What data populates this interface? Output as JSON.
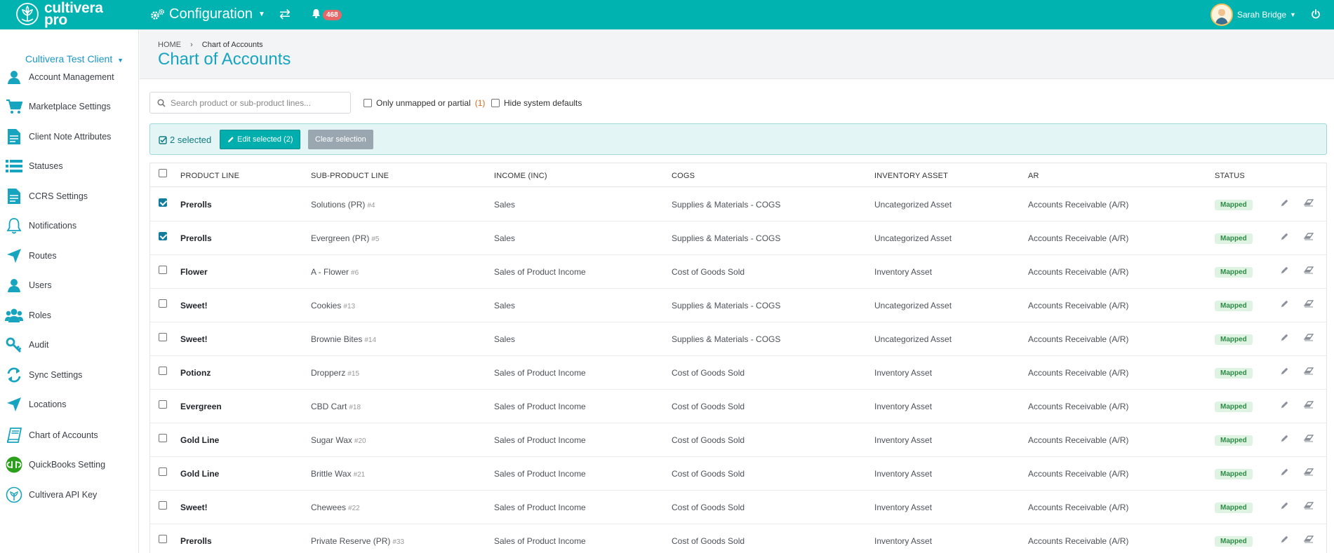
{
  "header": {
    "brand_line1": "cultivera",
    "brand_line2": "pro",
    "section": "Configuration",
    "notification_count": "468",
    "user_name": "Sarah Bridge",
    "icons": {
      "section": "gears-icon",
      "swap": "swap-arrows-icon",
      "bell": "bell-icon",
      "power": "power-icon"
    }
  },
  "sidebar": {
    "client": "Cultivera Test Client",
    "items": [
      {
        "label": "Account Management",
        "icon": "user-icon"
      },
      {
        "label": "Marketplace Settings",
        "icon": "cart-icon"
      },
      {
        "label": "Client Note Attributes",
        "icon": "document-icon"
      },
      {
        "label": "Statuses",
        "icon": "list-icon"
      },
      {
        "label": "CCRS Settings",
        "icon": "document-icon"
      },
      {
        "label": "Notifications",
        "icon": "bell-icon"
      },
      {
        "label": "Routes",
        "icon": "location-arrow-icon"
      },
      {
        "label": "Users",
        "icon": "user-icon"
      },
      {
        "label": "Roles",
        "icon": "users-icon"
      },
      {
        "label": "Audit",
        "icon": "key-icon"
      },
      {
        "label": "Sync Settings",
        "icon": "sync-icon"
      },
      {
        "label": "Locations",
        "icon": "location-arrow-icon"
      },
      {
        "label": "Chart of Accounts",
        "icon": "book-icon"
      },
      {
        "label": "QuickBooks Setting",
        "icon": "quickbooks-icon"
      },
      {
        "label": "Cultivera API Key",
        "icon": "api-key-icon"
      }
    ]
  },
  "breadcrumb": {
    "home": "HOME",
    "current": "Chart of Accounts"
  },
  "page_title": "Chart of Accounts",
  "filters": {
    "search_placeholder": "Search product or sub-product lines...",
    "only_unmapped_label": "Only unmapped or partial",
    "only_unmapped_count": "(1)",
    "hide_defaults_label": "Hide system defaults"
  },
  "selection": {
    "count_label": "2 selected",
    "edit_button": "Edit selected (2)",
    "clear_button": "Clear selection"
  },
  "table": {
    "columns": [
      "PRODUCT LINE",
      "SUB-PRODUCT LINE",
      "INCOME (INC)",
      "COGS",
      "INVENTORY ASSET",
      "AR",
      "STATUS"
    ],
    "rows": [
      {
        "checked": true,
        "product_line": "Prerolls",
        "sub_product": "Solutions (PR)",
        "sub_id": "#4",
        "income": "Sales",
        "cogs": "Supplies & Materials - COGS",
        "inventory": "Uncategorized Asset",
        "ar": "Accounts Receivable (A/R)",
        "status": "Mapped"
      },
      {
        "checked": true,
        "product_line": "Prerolls",
        "sub_product": "Evergreen (PR)",
        "sub_id": "#5",
        "income": "Sales",
        "cogs": "Supplies & Materials - COGS",
        "inventory": "Uncategorized Asset",
        "ar": "Accounts Receivable (A/R)",
        "status": "Mapped"
      },
      {
        "checked": false,
        "product_line": "Flower",
        "sub_product": "A - Flower",
        "sub_id": "#6",
        "income": "Sales of Product Income",
        "cogs": "Cost of Goods Sold",
        "inventory": "Inventory Asset",
        "ar": "Accounts Receivable (A/R)",
        "status": "Mapped"
      },
      {
        "checked": false,
        "product_line": "Sweet!",
        "sub_product": "Cookies",
        "sub_id": "#13",
        "income": "Sales",
        "cogs": "Supplies & Materials - COGS",
        "inventory": "Uncategorized Asset",
        "ar": "Accounts Receivable (A/R)",
        "status": "Mapped"
      },
      {
        "checked": false,
        "product_line": "Sweet!",
        "sub_product": "Brownie Bites",
        "sub_id": "#14",
        "income": "Sales",
        "cogs": "Supplies & Materials - COGS",
        "inventory": "Uncategorized Asset",
        "ar": "Accounts Receivable (A/R)",
        "status": "Mapped"
      },
      {
        "checked": false,
        "product_line": "Potionz",
        "sub_product": "Dropperz",
        "sub_id": "#15",
        "income": "Sales of Product Income",
        "cogs": "Cost of Goods Sold",
        "inventory": "Inventory Asset",
        "ar": "Accounts Receivable (A/R)",
        "status": "Mapped"
      },
      {
        "checked": false,
        "product_line": "Evergreen",
        "sub_product": "CBD Cart",
        "sub_id": "#18",
        "income": "Sales of Product Income",
        "cogs": "Cost of Goods Sold",
        "inventory": "Inventory Asset",
        "ar": "Accounts Receivable (A/R)",
        "status": "Mapped"
      },
      {
        "checked": false,
        "product_line": "Gold Line",
        "sub_product": "Sugar Wax",
        "sub_id": "#20",
        "income": "Sales of Product Income",
        "cogs": "Cost of Goods Sold",
        "inventory": "Inventory Asset",
        "ar": "Accounts Receivable (A/R)",
        "status": "Mapped"
      },
      {
        "checked": false,
        "product_line": "Gold Line",
        "sub_product": "Brittle Wax",
        "sub_id": "#21",
        "income": "Sales of Product Income",
        "cogs": "Cost of Goods Sold",
        "inventory": "Inventory Asset",
        "ar": "Accounts Receivable (A/R)",
        "status": "Mapped"
      },
      {
        "checked": false,
        "product_line": "Sweet!",
        "sub_product": "Chewees",
        "sub_id": "#22",
        "income": "Sales of Product Income",
        "cogs": "Cost of Goods Sold",
        "inventory": "Inventory Asset",
        "ar": "Accounts Receivable (A/R)",
        "status": "Mapped"
      },
      {
        "checked": false,
        "product_line": "Prerolls",
        "sub_product": "Private Reserve (PR)",
        "sub_id": "#33",
        "income": "Sales of Product Income",
        "cogs": "Cost of Goods Sold",
        "inventory": "Inventory Asset",
        "ar": "Accounts Receivable (A/R)",
        "status": "Mapped"
      }
    ]
  },
  "colors": {
    "brand_teal": "#00b3b1",
    "title_blue": "#17a4bf",
    "mapped_green": "#2e8b47",
    "badge_red": "#e66767"
  }
}
